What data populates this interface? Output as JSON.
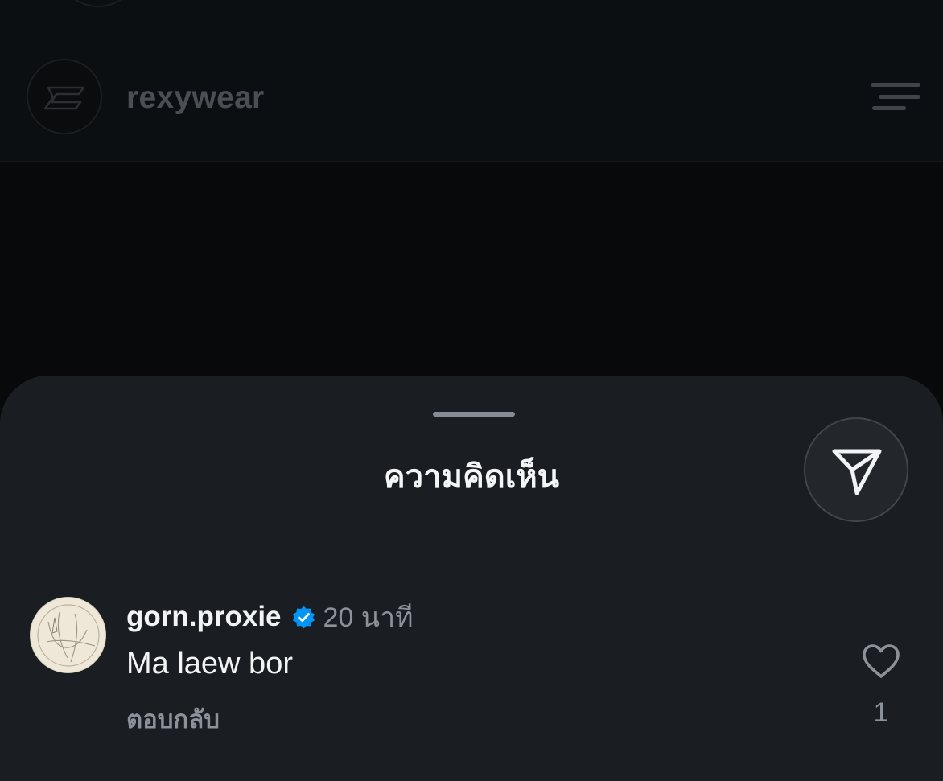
{
  "header": {
    "username": "rexywear",
    "avatar_icon": "brand-logo-icon",
    "menu_icon": "menu-icon"
  },
  "comments_sheet": {
    "title": "ความคิดเห็น",
    "share_icon": "send-icon",
    "comments": [
      {
        "username": "gorn.proxie",
        "verified": true,
        "time": "20 นาที",
        "text": "Ma laew bor",
        "reply_label": "ตอบกลับ",
        "like_count": "1"
      }
    ]
  },
  "colors": {
    "background": "#07090b",
    "sheet": "#1a1d21",
    "verified": "#0095f6",
    "muted_text": "#8c929a"
  }
}
